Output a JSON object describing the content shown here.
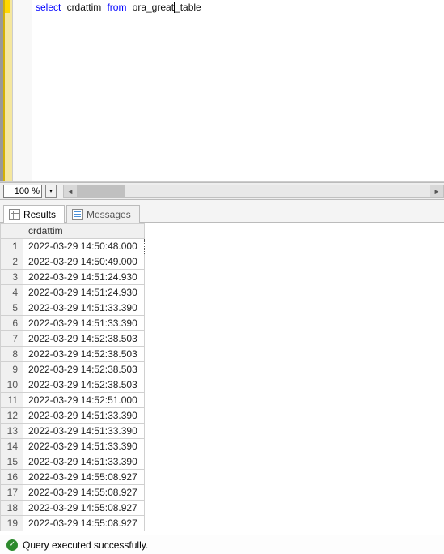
{
  "editor": {
    "code_html": "<span class='kw'>select</span> <span class='identdark'>crdattim</span> <span class='kw'>from</span> <span class='identdark'>ora_great</span><span class='cursor-line'></span><span class='identdark'>_table</span>"
  },
  "zoom": {
    "value": "100 %"
  },
  "tabs": {
    "results": "Results",
    "messages": "Messages"
  },
  "grid": {
    "column": "crdattim",
    "rows": [
      "2022-03-29 14:50:48.000",
      "2022-03-29 14:50:49.000",
      "2022-03-29 14:51:24.930",
      "2022-03-29 14:51:24.930",
      "2022-03-29 14:51:33.390",
      "2022-03-29 14:51:33.390",
      "2022-03-29 14:52:38.503",
      "2022-03-29 14:52:38.503",
      "2022-03-29 14:52:38.503",
      "2022-03-29 14:52:38.503",
      "2022-03-29 14:52:51.000",
      "2022-03-29 14:51:33.390",
      "2022-03-29 14:51:33.390",
      "2022-03-29 14:51:33.390",
      "2022-03-29 14:51:33.390",
      "2022-03-29 14:55:08.927",
      "2022-03-29 14:55:08.927",
      "2022-03-29 14:55:08.927",
      "2022-03-29 14:55:08.927"
    ]
  },
  "status": {
    "text": "Query executed successfully."
  }
}
